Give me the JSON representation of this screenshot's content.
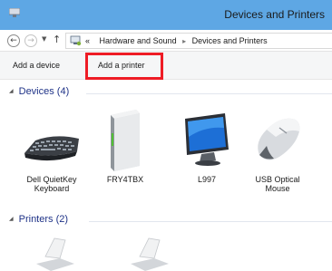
{
  "window": {
    "title": "Devices and Printers"
  },
  "addressbar": {
    "crumbs": [
      "Hardware and Sound",
      "Devices and Printers"
    ],
    "overflow": "«"
  },
  "commands": {
    "add_device": "Add a device",
    "add_printer": "Add a printer"
  },
  "groups": {
    "devices": "Devices (4)",
    "printers": "Printers (2)"
  },
  "devices": [
    {
      "label1": "Dell QuietKey",
      "label2": "Keyboard",
      "icon": "keyboard-icon"
    },
    {
      "label1": "FRY4TBX",
      "label2": "",
      "icon": "computer-tower-icon"
    },
    {
      "label1": "L997",
      "label2": "",
      "icon": "monitor-icon"
    },
    {
      "label1": "USB Optical",
      "label2": "Mouse",
      "icon": "mouse-icon"
    }
  ],
  "colors": {
    "titlebar": "#5ea7e4",
    "highlight": "#ee1c25",
    "group_header": "#1e3287"
  }
}
